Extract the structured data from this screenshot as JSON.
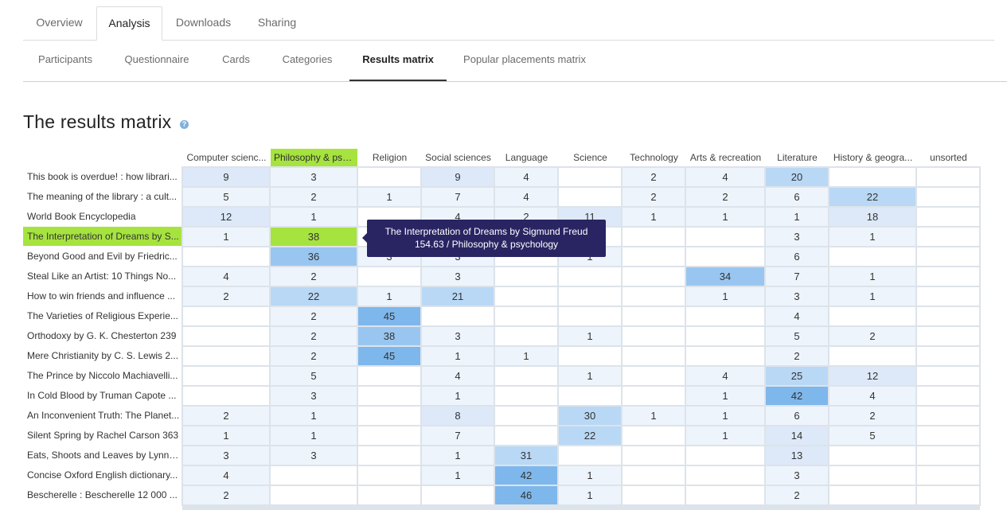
{
  "primary_tabs": [
    {
      "label": "Overview",
      "active": false
    },
    {
      "label": "Analysis",
      "active": true
    },
    {
      "label": "Downloads",
      "active": false
    },
    {
      "label": "Sharing",
      "active": false
    }
  ],
  "secondary_tabs": [
    {
      "label": "Participants",
      "active": false
    },
    {
      "label": "Questionnaire",
      "active": false
    },
    {
      "label": "Cards",
      "active": false
    },
    {
      "label": "Categories",
      "active": false
    },
    {
      "label": "Results matrix",
      "active": true
    },
    {
      "label": "Popular placements matrix",
      "active": false
    }
  ],
  "page_title": "The results matrix",
  "help_icon": "?",
  "colors": {
    "highlight": "#a6e33f",
    "tooltip_bg": "#292563",
    "grid": "#dde3ea"
  },
  "matrix": {
    "columns": [
      "Computer scienc...",
      "Philosophy & psy...",
      "Religion",
      "Social sciences",
      "Language",
      "Science",
      "Technology",
      "Arts & recreation",
      "Literature",
      "History & geogra...",
      "unsorted"
    ],
    "highlighted_column": 1,
    "highlighted_row": 3,
    "rows": [
      {
        "label": "This book is overdue! : how librari...",
        "values": [
          "9",
          "3",
          "",
          "9",
          "4",
          "",
          "2",
          "4",
          "20",
          "",
          ""
        ]
      },
      {
        "label": "The meaning of the library : a cult...",
        "values": [
          "5",
          "2",
          "1",
          "7",
          "4",
          "",
          "2",
          "2",
          "6",
          "22",
          ""
        ]
      },
      {
        "label": "World Book Encyclopedia",
        "values": [
          "12",
          "1",
          "",
          "4",
          "2",
          "11",
          "1",
          "1",
          "1",
          "18",
          ""
        ]
      },
      {
        "label": "The Interpretation of Dreams by S...",
        "values": [
          "1",
          "38",
          "",
          "",
          "",
          "",
          "",
          "",
          "3",
          "1",
          ""
        ]
      },
      {
        "label": "Beyond Good and Evil by Friedric...",
        "values": [
          "",
          "36",
          "3",
          "3",
          "",
          "1",
          "",
          "",
          "6",
          "",
          ""
        ]
      },
      {
        "label": "Steal Like an Artist: 10 Things No...",
        "values": [
          "4",
          "2",
          "",
          "3",
          "",
          "",
          "",
          "34",
          "7",
          "1",
          ""
        ]
      },
      {
        "label": "How to win friends and influence ...",
        "values": [
          "2",
          "22",
          "1",
          "21",
          "",
          "",
          "",
          "1",
          "3",
          "1",
          ""
        ]
      },
      {
        "label": "The Varieties of Religious Experie...",
        "values": [
          "",
          "2",
          "45",
          "",
          "",
          "",
          "",
          "",
          "4",
          "",
          ""
        ]
      },
      {
        "label": "Orthodoxy by G. K. Chesterton 239",
        "values": [
          "",
          "2",
          "38",
          "3",
          "",
          "1",
          "",
          "",
          "5",
          "2",
          ""
        ]
      },
      {
        "label": "Mere Christianity by C. S. Lewis 2...",
        "values": [
          "",
          "2",
          "45",
          "1",
          "1",
          "",
          "",
          "",
          "2",
          "",
          ""
        ]
      },
      {
        "label": "The Prince by Niccolo Machiavelli...",
        "values": [
          "",
          "5",
          "",
          "4",
          "",
          "1",
          "",
          "4",
          "25",
          "12",
          ""
        ]
      },
      {
        "label": "In Cold Blood by Truman Capote ...",
        "values": [
          "",
          "3",
          "",
          "1",
          "",
          "",
          "",
          "1",
          "42",
          "4",
          ""
        ]
      },
      {
        "label": "An Inconvenient Truth: The Planet...",
        "values": [
          "2",
          "1",
          "",
          "8",
          "",
          "30",
          "1",
          "1",
          "6",
          "2",
          ""
        ]
      },
      {
        "label": "Silent Spring by Rachel Carson 363",
        "values": [
          "1",
          "1",
          "",
          "7",
          "",
          "22",
          "",
          "1",
          "14",
          "5",
          ""
        ]
      },
      {
        "label": "Eats, Shoots and Leaves by Lynne...",
        "values": [
          "3",
          "3",
          "",
          "1",
          "31",
          "",
          "",
          "",
          "13",
          "",
          ""
        ]
      },
      {
        "label": "Concise Oxford English dictionary...",
        "values": [
          "4",
          "",
          "",
          "1",
          "42",
          "1",
          "",
          "",
          "3",
          "",
          ""
        ]
      },
      {
        "label": "Bescherelle : Bescherelle 12 000 ...",
        "values": [
          "2",
          "",
          "",
          "",
          "46",
          "1",
          "",
          "",
          "2",
          "",
          ""
        ]
      }
    ]
  },
  "tooltip": {
    "line1": "The Interpretation of Dreams by Sigmund Freud",
    "line2": "154.63 / Philosophy & psychology"
  }
}
